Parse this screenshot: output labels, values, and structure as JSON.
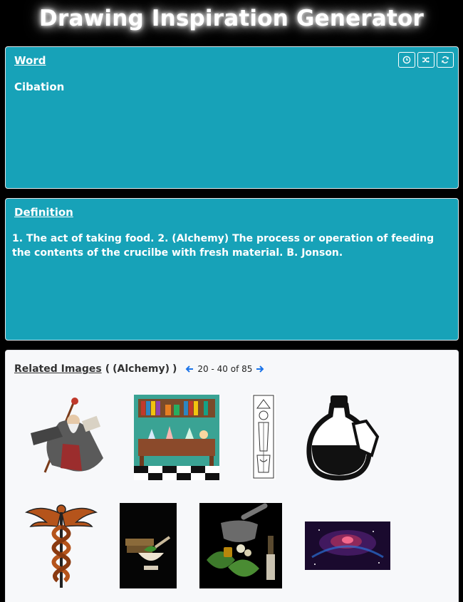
{
  "app": {
    "title": "Drawing Inspiration Generator"
  },
  "word_panel": {
    "heading": "Word",
    "word": "Cibation",
    "tools": [
      "clock-icon",
      "shuffle-icon",
      "refresh-icon"
    ]
  },
  "definition_panel": {
    "heading": "Definition",
    "text": "1. The act of taking food. 2. (Alchemy) The process or operation of feeding the contents of the crucilbe with fresh material. B. Jonson."
  },
  "images_panel": {
    "heading": "Related Images",
    "open_paren": "(",
    "category": "(Alchemy)",
    "close_paren": ")",
    "pager_range": "20 - 40 of 85",
    "images": [
      {
        "subject": "wizard"
      },
      {
        "subject": "alchemy laboratory"
      },
      {
        "subject": "alchemical engraving"
      },
      {
        "subject": "potion bottle"
      },
      {
        "subject": "caduceus"
      },
      {
        "subject": "mortar with herbs"
      },
      {
        "subject": "herbal remedies"
      },
      {
        "subject": "nebula"
      }
    ]
  },
  "colors": {
    "accent": "#17a2b8",
    "page_bg": "#000000",
    "images_bg": "#f7f8fa",
    "pager_arrow": "#1a73e8"
  }
}
